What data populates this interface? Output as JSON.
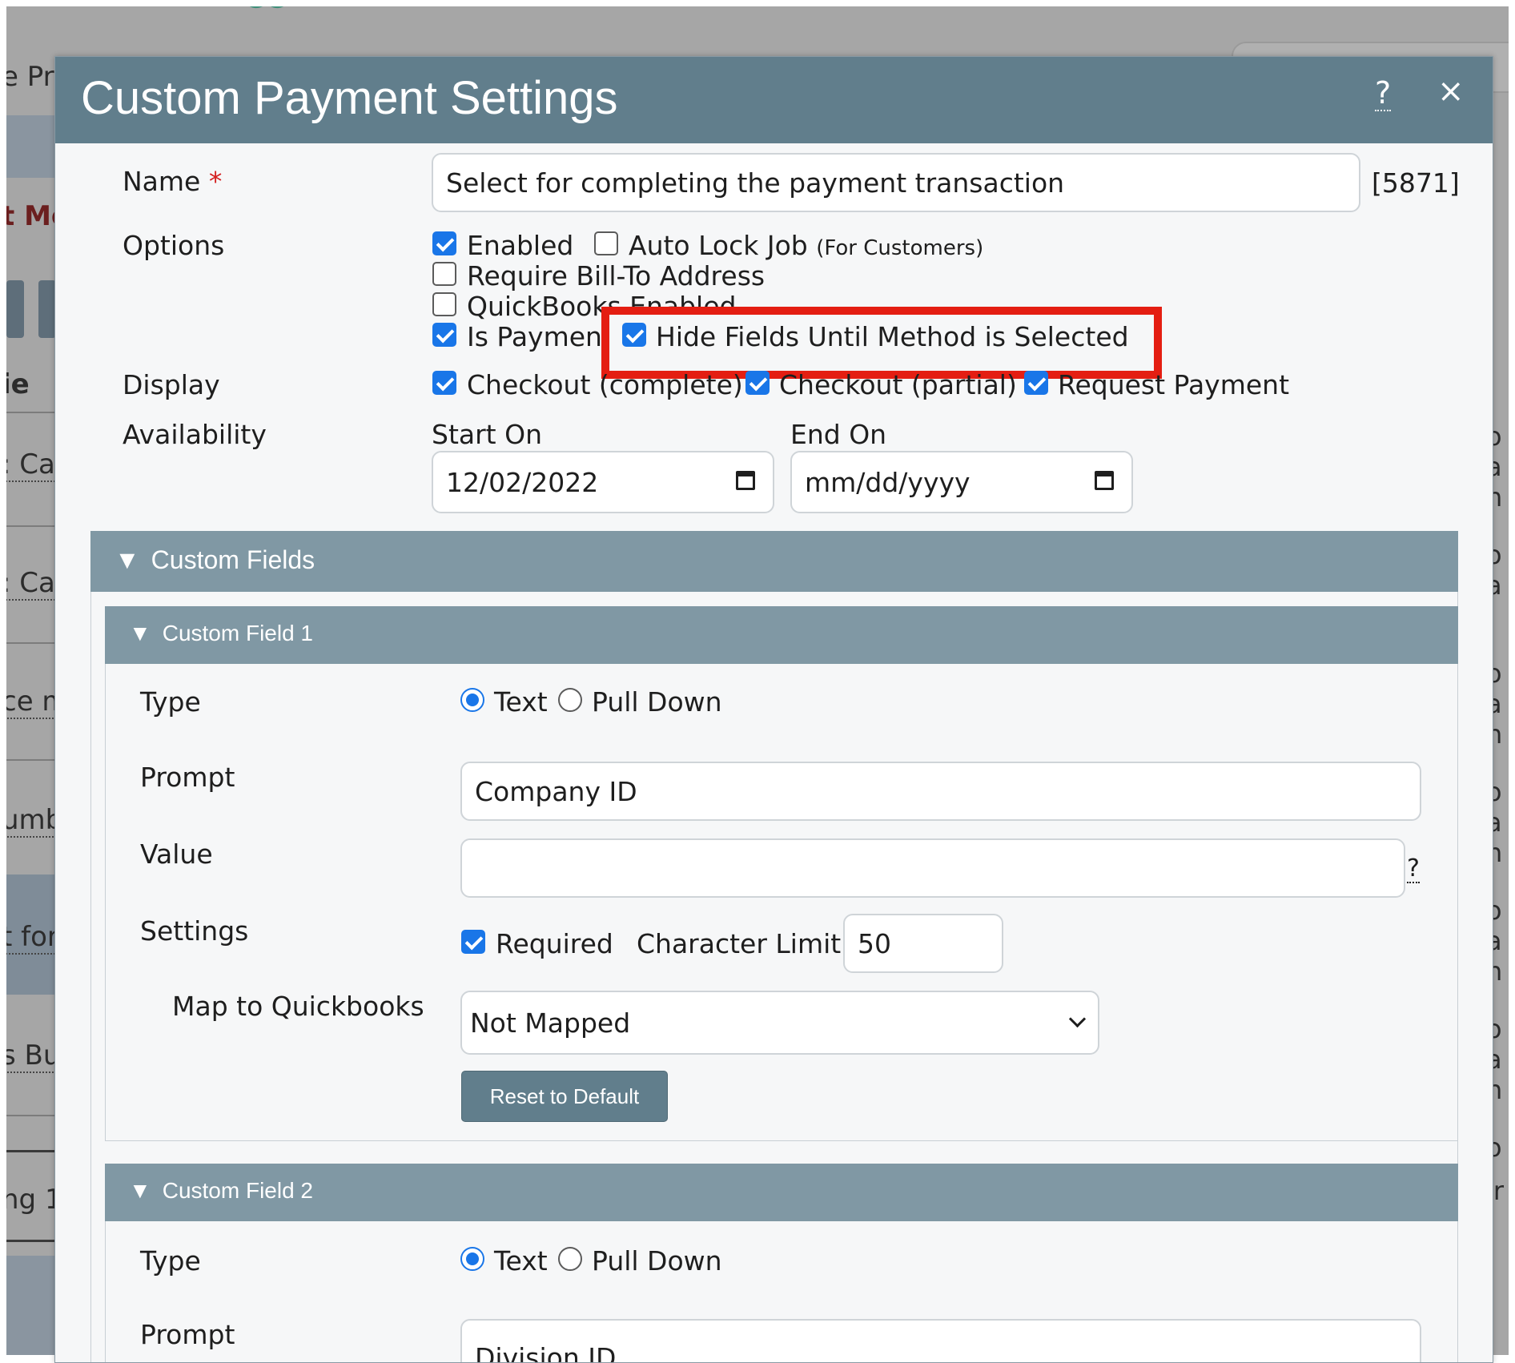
{
  "background": {
    "left_texts": [
      "e Pr",
      "t Me",
      "ie",
      ": Ca",
      ": Ca",
      "ce m",
      "umb",
      "t for",
      "s Bu",
      "ng 1"
    ],
    "right_chars": [
      "o",
      "a",
      "n",
      "o",
      "a",
      "o",
      "a",
      "n",
      "o",
      "a",
      "n",
      "o",
      "a",
      "n",
      "o",
      "a",
      "n",
      "o",
      "ir"
    ]
  },
  "dialog": {
    "title": "Custom Payment Settings",
    "help_label": "?",
    "close_label": "×"
  },
  "form": {
    "name_label": "Name",
    "required_marker": "*",
    "name_value": "Select for completing the payment transaction",
    "record_id": "[5871]",
    "options_label": "Options",
    "options": {
      "enabled": {
        "label": "Enabled",
        "checked": true
      },
      "auto_lock": {
        "label": "Auto Lock Job",
        "note": "(For Customers)",
        "checked": false
      },
      "require_bill_to": {
        "label": "Require Bill-To Address",
        "checked": false
      },
      "quickbooks": {
        "label": "QuickBooks Enabled",
        "checked": false
      },
      "is_payment": {
        "label": "Is Payment",
        "checked": true
      },
      "hide_fields": {
        "label": "Hide Fields Until Method is Selected",
        "checked": true
      }
    },
    "display_label": "Display",
    "display": {
      "checkout_complete": {
        "label": "Checkout (complete)",
        "checked": true
      },
      "checkout_partial": {
        "label": "Checkout (partial)",
        "checked": true
      },
      "request_payment": {
        "label": "Request Payment",
        "checked": true
      }
    },
    "availability_label": "Availability",
    "start_on_label": "Start On",
    "start_on_value": "12/02/2022",
    "end_on_label": "End On",
    "end_on_placeholder": "mm/dd/yyyy"
  },
  "custom_fields": {
    "header": "Custom Fields",
    "field1": {
      "header": "Custom Field 1",
      "type_label": "Type",
      "type_text": "Text",
      "type_pulldown": "Pull Down",
      "selected_type": "Text",
      "prompt_label": "Prompt",
      "prompt_value": "Company ID",
      "value_label": "Value",
      "value_value": "",
      "value_help": "?",
      "settings_label": "Settings",
      "required_label": "Required",
      "required_checked": true,
      "char_limit_label": "Character Limit",
      "char_limit_value": "50",
      "map_label": "Map to Quickbooks",
      "map_value": "Not Mapped",
      "reset_label": "Reset to Default"
    },
    "field2": {
      "header": "Custom Field 2",
      "type_label": "Type",
      "type_text": "Text",
      "type_pulldown": "Pull Down",
      "selected_type": "Text",
      "prompt_label": "Prompt",
      "prompt_value": "Division ID"
    }
  },
  "annotation": {
    "color": "#e41e12"
  },
  "colors": {
    "titlebar": "#617e8c",
    "section": "#8098a4",
    "checkbox": "#1976e8"
  }
}
